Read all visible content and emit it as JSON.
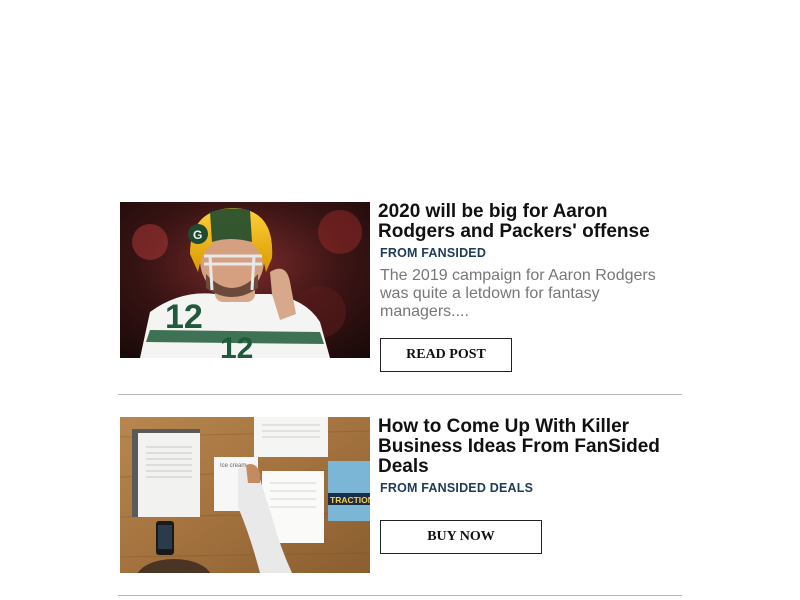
{
  "feed": {
    "items": [
      {
        "title": "2020 will be big for Aaron Rodgers and Packers' offense",
        "source": "FROM FANSIDED",
        "excerpt": "The 2019 campaign for Aaron Rodgers was quite a letdown for fantasy managers....",
        "cta_label": "READ POST",
        "image": "football-player-photo"
      },
      {
        "title": "How to Come Up With Killer Business Ideas From FanSided Deals",
        "source": "FROM FANSIDED DEALS",
        "cta_label": "BUY NOW",
        "image": "desk-papers-photo",
        "image_book_title": "TRACTION"
      }
    ]
  },
  "colors": {
    "title": "#111111",
    "source": "#1f3a5a",
    "excerpt": "#777777",
    "divider": "#b8b8b8",
    "packers_green": "#203731",
    "packers_gold": "#ffb612"
  }
}
